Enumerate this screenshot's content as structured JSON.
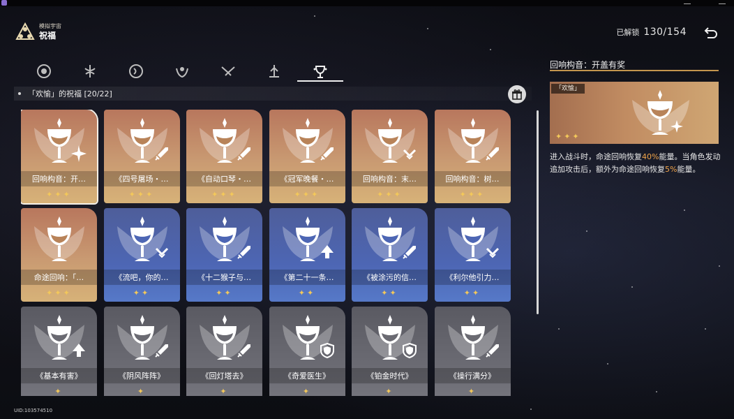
{
  "header": {
    "subtitle": "模拟宇宙",
    "title": "祝福",
    "unlock_label": "已解锁",
    "unlock_count": "130/154"
  },
  "tabs": [
    {
      "icon": "preservation-path-icon",
      "active": false
    },
    {
      "icon": "remembrance-path-icon",
      "active": false
    },
    {
      "icon": "nihility-path-icon",
      "active": false
    },
    {
      "icon": "abundance-path-icon",
      "active": false
    },
    {
      "icon": "hunt-path-icon",
      "active": false
    },
    {
      "icon": "destruction-path-icon",
      "active": false
    },
    {
      "icon": "elation-path-icon",
      "active": true
    }
  ],
  "section": {
    "title": "「欢愉」的祝福 [20/22]"
  },
  "cards": [
    {
      "name": "回响构音：开…",
      "stars": "✦✦✦",
      "tier": "gold",
      "badge": "star-burst-icon",
      "selected": true
    },
    {
      "name": "《四号屠场・…",
      "stars": "✦✦✦",
      "tier": "gold",
      "badge": "sword-icon"
    },
    {
      "name": "《自动口琴・…",
      "stars": "✦✦✦",
      "tier": "gold",
      "badge": "sword-icon"
    },
    {
      "name": "《冠军晚餐・…",
      "stars": "✦✦✦",
      "tier": "gold",
      "badge": "sword-icon"
    },
    {
      "name": "回响构音：末…",
      "stars": "✦✦✦",
      "tier": "gold",
      "badge": "chevron-check-icon"
    },
    {
      "name": "回响构音：树…",
      "stars": "✦✦✦",
      "tier": "gold",
      "badge": "sword-icon"
    },
    {
      "name": "命途回响：「…",
      "stars": "✦✦✦",
      "tier": "gold",
      "badge": "none"
    },
    {
      "name": "《流吧，你的…",
      "stars": "✦✦",
      "tier": "blue",
      "badge": "chevron-check-icon"
    },
    {
      "name": "《十二猴子与…",
      "stars": "✦✦",
      "tier": "blue",
      "badge": "sword-icon"
    },
    {
      "name": "《第二十一条…",
      "stars": "✦✦",
      "tier": "blue",
      "badge": "arrow-up-icon"
    },
    {
      "name": "《被涂污的信…",
      "stars": "✦✦",
      "tier": "blue",
      "badge": "sword-icon"
    },
    {
      "name": "《利尔他引力…",
      "stars": "✦✦",
      "tier": "blue",
      "badge": "chevron-check-icon"
    },
    {
      "name": "《基本有害》",
      "stars": "✦",
      "tier": "gray",
      "badge": "arrow-up-icon"
    },
    {
      "name": "《阴风阵阵》",
      "stars": "✦",
      "tier": "gray",
      "badge": "sword-icon"
    },
    {
      "name": "《回灯塔去》",
      "stars": "✦",
      "tier": "gray",
      "badge": "sword-icon"
    },
    {
      "name": "《奇爱医生》",
      "stars": "✦",
      "tier": "gray",
      "badge": "shield-icon"
    },
    {
      "name": "《铂金时代》",
      "stars": "✦",
      "tier": "gray",
      "badge": "shield-icon"
    },
    {
      "name": "《操行满分》",
      "stars": "✦",
      "tier": "gray",
      "badge": "sword-icon"
    }
  ],
  "detail": {
    "title": "回响构音：开盖有奖",
    "tag": "「欢愉」",
    "stars": "✦✦✦",
    "desc_1": "进入战斗时，命途回响恢复",
    "desc_hl_1": "40%",
    "desc_2": "能量。当角色发动追加攻击后，额外为命途回响恢复",
    "desc_hl_2": "5%",
    "desc_3": "能量。"
  },
  "footer": {
    "uid": "UID:103574510"
  },
  "colors": {
    "gold_card": "#c99a72",
    "blue_card": "#4d66b4",
    "gray_card": "#6a6a72",
    "star": "#f3c85a",
    "highlight": "#f0a44a",
    "accent_line": "#c4964e"
  }
}
